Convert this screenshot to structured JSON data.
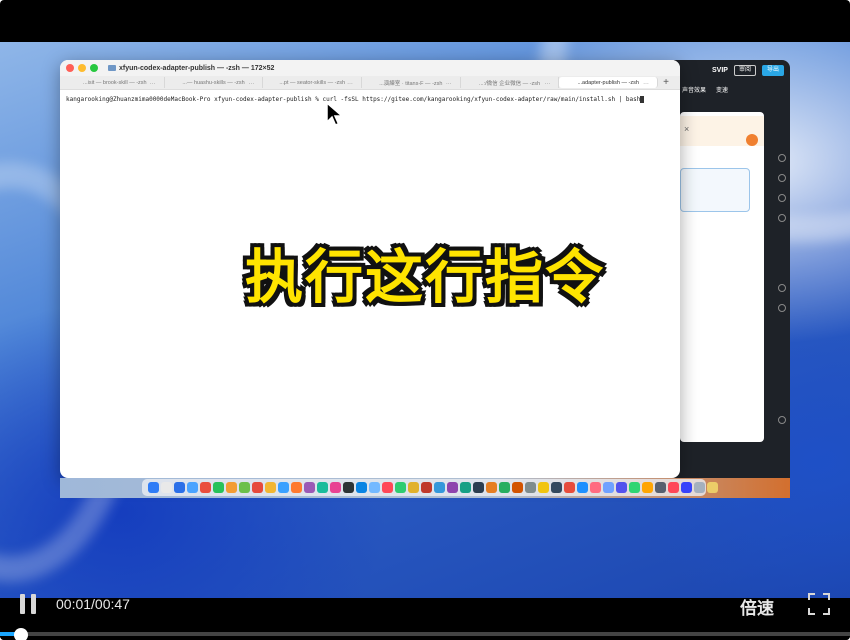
{
  "terminal": {
    "window_title": "xfyun-codex-adapter-publish — -zsh — 172×52",
    "tabs": [
      {
        "label": "...isit — brook-skill — -zsh",
        "active": false
      },
      {
        "label": "...— huashu-skills — -zsh",
        "active": false
      },
      {
        "label": "...pt — seator-skills — -zsh",
        "active": false
      },
      {
        "label": "...演練室 · titans-F — -zsh",
        "active": false
      },
      {
        "label": "...:/微信 企业微信 — -zsh",
        "active": false
      },
      {
        "label": "...adapter-publish — -zsh",
        "active": true
      }
    ],
    "new_tab": "+",
    "prompt": "kangarooking@Zhuanzmima0000deMacBook-Pro xfyun-codex-adapter-publish %",
    "command": "curl -fsSL https://gitee.com/kangarooking/xfyun-codex-adapter/raw/main/install.sh | bash"
  },
  "bg_app": {
    "svip": "SVIP",
    "btn1": "审阅",
    "btn2": "导出",
    "tab1": "声音效果",
    "tab2": "变速",
    "notice_close": "×"
  },
  "caption": "执行这行指令",
  "player": {
    "time": "00:01/00:47",
    "speed_label": "倍速",
    "progress_fraction": 0.021
  },
  "colors": {
    "caption_fill": "#ffe400",
    "progress": "#1aa6ff",
    "traffic": [
      "#ff5f57",
      "#febc2e",
      "#28c840"
    ]
  },
  "dock_colors": [
    "#2f7cf6",
    "#e9e9e9",
    "#2b6fe8",
    "#4aa3ff",
    "#ea4d3d",
    "#27c25a",
    "#f39c34",
    "#6cc04a",
    "#e64a3c",
    "#f2b632",
    "#3aa0ff",
    "#ff7a2f",
    "#9b59b6",
    "#1abc9c",
    "#e84393",
    "#2d3436",
    "#0984e3",
    "#74b9ff",
    "#ff4757",
    "#2ecc71",
    "#e1b12c",
    "#c0392b",
    "#3498db",
    "#8e44ad",
    "#16a085",
    "#2c3e50",
    "#e67e22",
    "#27ae60",
    "#d35400",
    "#7f8c8d",
    "#f1c40f",
    "#34495e",
    "#e74c3c",
    "#1e90ff",
    "#ff6b81",
    "#70a1ff",
    "#5352ed",
    "#2ed573",
    "#ffa502",
    "#57606f",
    "#ff4757",
    "#3742fa",
    "#a4b0be",
    "#eccc68"
  ]
}
